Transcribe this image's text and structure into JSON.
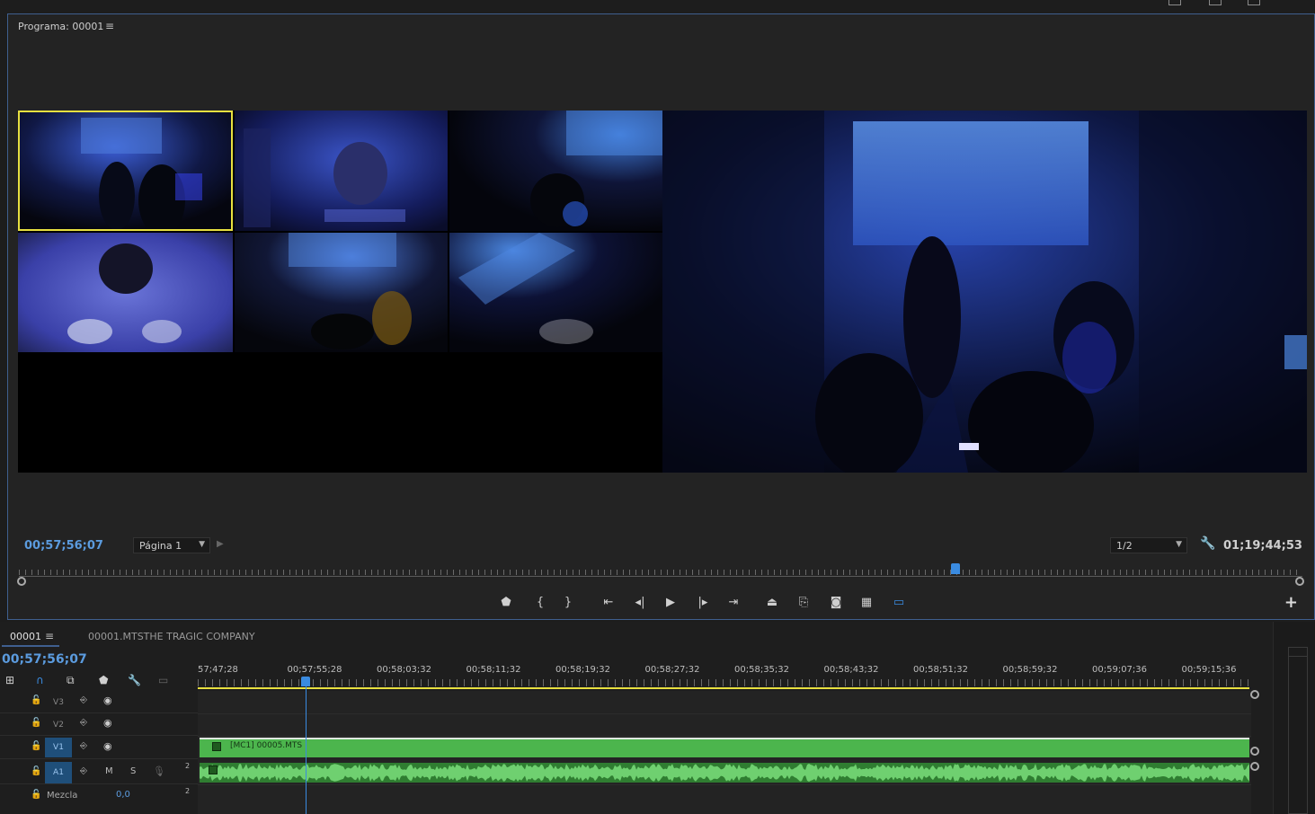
{
  "program_monitor": {
    "title": "Programa: 00001",
    "menu_icon": "hamburger-menu-icon",
    "current_timecode": "00;57;56;07",
    "page_select": "Página 1",
    "ratio_select": "1/2",
    "duration_timecode": "01;19;44;53",
    "playhead_position": 0.73
  },
  "transport": {
    "buttons": [
      {
        "name": "add-marker-button",
        "icon": "marker-icon",
        "glyph": "⬟"
      },
      {
        "name": "mark-in-button",
        "icon": "mark-in-icon",
        "glyph": "{"
      },
      {
        "name": "mark-out-button",
        "icon": "mark-out-icon",
        "glyph": "}"
      },
      {
        "name": "go-to-in-button",
        "icon": "go-to-in-icon",
        "glyph": "⇤"
      },
      {
        "name": "step-back-button",
        "icon": "step-back-icon",
        "glyph": "◂|"
      },
      {
        "name": "play-button",
        "icon": "play-icon",
        "glyph": "▶"
      },
      {
        "name": "step-forward-button",
        "icon": "step-forward-icon",
        "glyph": "|▸"
      },
      {
        "name": "go-to-out-button",
        "icon": "go-to-out-icon",
        "glyph": "⇥"
      },
      {
        "name": "lift-button",
        "icon": "lift-icon",
        "glyph": "⏏"
      },
      {
        "name": "extract-button",
        "icon": "extract-icon",
        "glyph": "⎘"
      },
      {
        "name": "export-frame-button",
        "icon": "camera-icon",
        "glyph": "◙"
      },
      {
        "name": "multi-camera-toggle-button",
        "icon": "multicam-icon",
        "glyph": "▦"
      },
      {
        "name": "comparison-view-button",
        "icon": "comparison-icon",
        "glyph": "▭"
      }
    ],
    "add_button": "+"
  },
  "timeline": {
    "sequence_tab": "00001",
    "second_tab": "00001.MTSTHE TRAGIC COMPANY",
    "current_timecode": "00;57;56;07",
    "ruler_labels": [
      "57;47;28",
      "00;57;55;28",
      "00;58;03;32",
      "00;58;11;32",
      "00;58;19;32",
      "00;58;27;32",
      "00;58;35;32",
      "00;58;43;32",
      "00;58;51;32",
      "00;58;59;32",
      "00;59;07;36",
      "00;59;15;36"
    ],
    "tracks": [
      {
        "name": "V3",
        "type": "video",
        "selected": false
      },
      {
        "name": "V2",
        "type": "video",
        "selected": false
      },
      {
        "name": "V1",
        "type": "video",
        "selected": true
      },
      {
        "name": "A1",
        "type": "audio",
        "selected": true,
        "mute": "M",
        "solo": "S",
        "channels": "2"
      }
    ],
    "mix": {
      "label": "Mezcla",
      "value": "0,0",
      "channels": "2"
    },
    "video_clip_label": "[MC1] 00005.MTS"
  },
  "colors": {
    "accent": "#3a8be0",
    "clip_green": "#4cb54d",
    "active_camera": "#e8e040",
    "panel_border": "#3f5f8f"
  }
}
